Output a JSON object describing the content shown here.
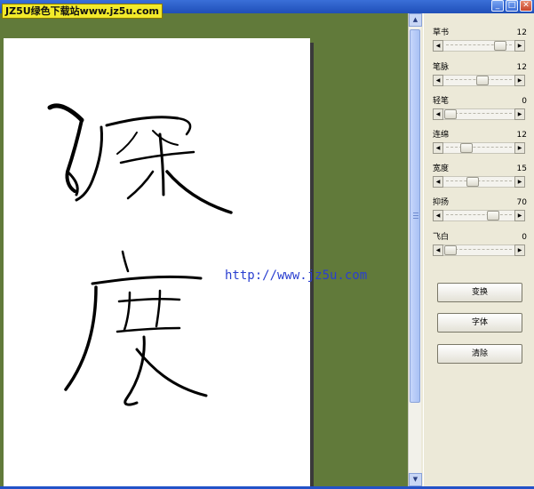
{
  "watermark": {
    "badge_text": "JZ5U绿色下载站www.jz5u.com",
    "url_text": "http://www.jz5u.com"
  },
  "window": {
    "minimize_glyph": "_",
    "maximize_glyph": "□",
    "close_glyph": "✕"
  },
  "canvas": {
    "background_color": "#617a3a",
    "paper_color": "#ffffff",
    "ink_color": "#000000",
    "artwork": "calligraphy of 深度 drawn as strokes"
  },
  "controls": [
    {
      "label": "草书",
      "value": "12",
      "level": 0.85
    },
    {
      "label": "笔脉",
      "value": "12",
      "level": 0.55
    },
    {
      "label": "轻笔",
      "value": "0",
      "level": 0.0
    },
    {
      "label": "连绵",
      "value": "12",
      "level": 0.28
    },
    {
      "label": "宽度",
      "value": "15",
      "level": 0.38
    },
    {
      "label": "抑扬",
      "value": "70",
      "level": 0.72
    },
    {
      "label": "飞白",
      "value": "0",
      "level": 0.0
    }
  ],
  "buttons": {
    "transform": "变换",
    "font": "字体",
    "clear": "清除"
  },
  "scroll": {
    "up_glyph": "▲",
    "down_glyph": "▼",
    "left_glyph": "◀",
    "right_glyph": "▶"
  }
}
